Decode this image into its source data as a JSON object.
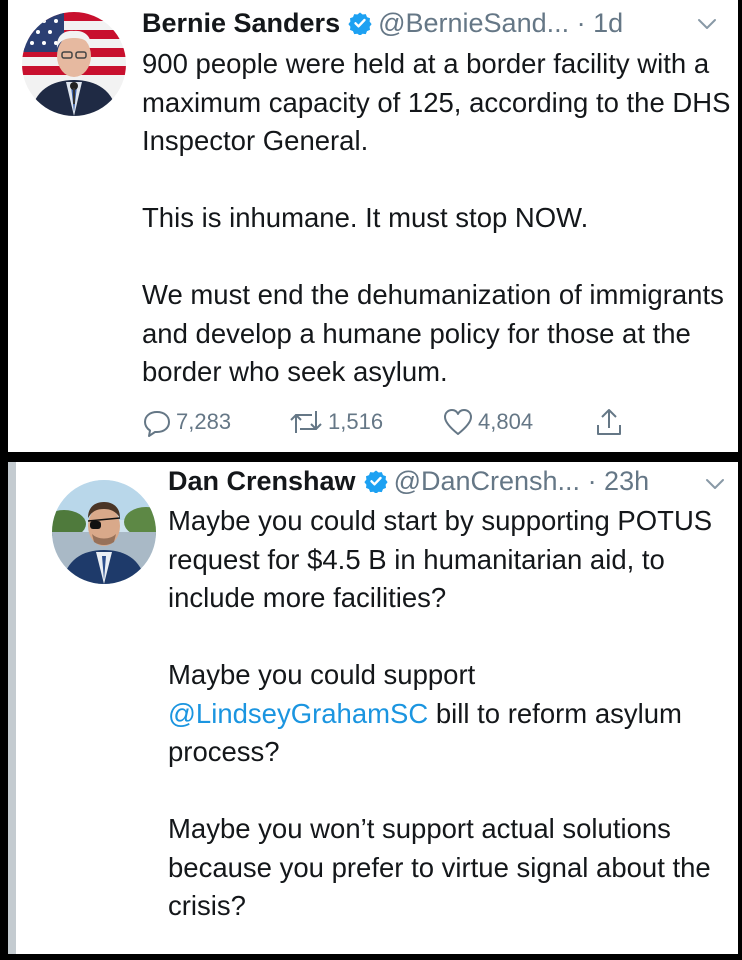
{
  "tweets": [
    {
      "name": "Bernie Sanders",
      "handle": "@BernieSand...",
      "time": "· 1d",
      "avatar_icon": "avatar-photo",
      "paragraphs": [
        "900 people were held at a border facility with a maximum capacity of 125, according to the DHS Inspector General.",
        "This is inhumane. It must stop NOW.",
        "We must end the dehumanization of immigrants and develop a humane policy for those at the border who seek asylum."
      ],
      "actions": {
        "replies": "7,283",
        "retweets": "1,516",
        "likes": "4,804"
      }
    },
    {
      "name": "Dan Crenshaw",
      "handle": "@DanCrensh...",
      "time": "· 23h",
      "avatar_icon": "avatar-photo",
      "p1": "Maybe you could start by supporting POTUS request for $4.5 B in humanitarian aid, to include more facilities?",
      "p2_prefix": "Maybe you could support ",
      "p2_mention": "@LindseyGrahamSC",
      "p2_suffix": " bill to reform asylum process?",
      "p3": "Maybe you won’t support actual solutions because you prefer to virtue signal about the crisis?"
    }
  ],
  "colors": {
    "text": "#14171a",
    "secondary": "#657786",
    "link": "#1b95e0",
    "verified": "#1da1f2",
    "frame": "#000000",
    "thread_line": "#c4cbd0"
  },
  "icons": [
    "verified-badge-icon",
    "chevron-down-icon",
    "reply-icon",
    "retweet-icon",
    "like-icon",
    "share-icon"
  ]
}
